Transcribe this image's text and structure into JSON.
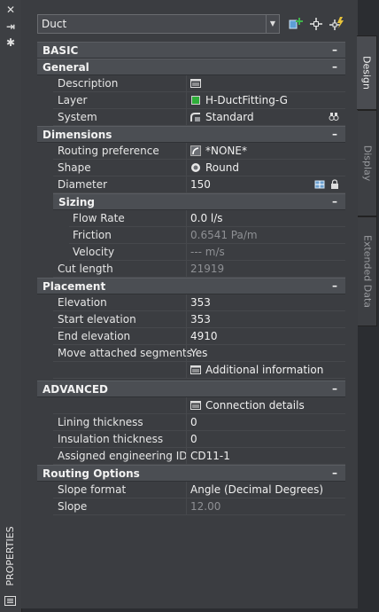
{
  "palette": {
    "title": "PROPERTIES",
    "close_glyph": "✕",
    "autohide_glyph": "⇥",
    "settings_glyph": "✱"
  },
  "toolbar": {
    "style_value": "Duct",
    "buttons": [
      "add-style-icon",
      "select-objects-icon",
      "quick-select-icon"
    ]
  },
  "tabs": [
    "Design",
    "Display",
    "Extended Data"
  ],
  "categories": {
    "basic": "BASIC",
    "general": "General",
    "dimensions": "Dimensions",
    "sizing": "Sizing",
    "placement": "Placement",
    "advanced": "ADVANCED",
    "routing_options": "Routing Options",
    "toggle": "–"
  },
  "general": {
    "description": {
      "label": "Description",
      "value": ""
    },
    "layer": {
      "label": "Layer",
      "value": "H-DuctFitting-G"
    },
    "system": {
      "label": "System",
      "value": "Standard"
    }
  },
  "dimensions": {
    "routing_preference": {
      "label": "Routing preference",
      "value": "*NONE*"
    },
    "shape": {
      "label": "Shape",
      "value": "Round"
    },
    "diameter": {
      "label": "Diameter",
      "value": "150"
    },
    "cut_length": {
      "label": "Cut length",
      "value": "21919"
    }
  },
  "sizing": {
    "flow_rate": {
      "label": "Flow Rate",
      "value": "0.0 l/s"
    },
    "friction": {
      "label": "Friction",
      "value": "0.6541 Pa/m"
    },
    "velocity": {
      "label": "Velocity",
      "value": "--- m/s"
    }
  },
  "placement": {
    "elevation": {
      "label": "Elevation",
      "value": "353"
    },
    "start_elevation": {
      "label": "Start elevation",
      "value": "353"
    },
    "end_elevation": {
      "label": "End elevation",
      "value": "4910"
    },
    "move_attached": {
      "label": "Move attached segments",
      "value": "Yes"
    },
    "additional_info": "Additional information"
  },
  "advanced": {
    "connection_details": "Connection details",
    "lining_thickness": {
      "label": "Lining thickness",
      "value": "0"
    },
    "insulation_thickness": {
      "label": "Insulation thickness",
      "value": "0"
    },
    "engineering_id": {
      "label": "Assigned engineering ID",
      "value": "CD11-1"
    }
  },
  "routing_options": {
    "slope_format": {
      "label": "Slope format",
      "value": "Angle (Decimal Degrees)"
    },
    "slope": {
      "label": "Slope",
      "value": "12.00"
    }
  },
  "colors": {
    "layer_swatch": "#2fae3a",
    "panel_bg": "#3b3d41",
    "category_bg": "#4b4e53"
  }
}
